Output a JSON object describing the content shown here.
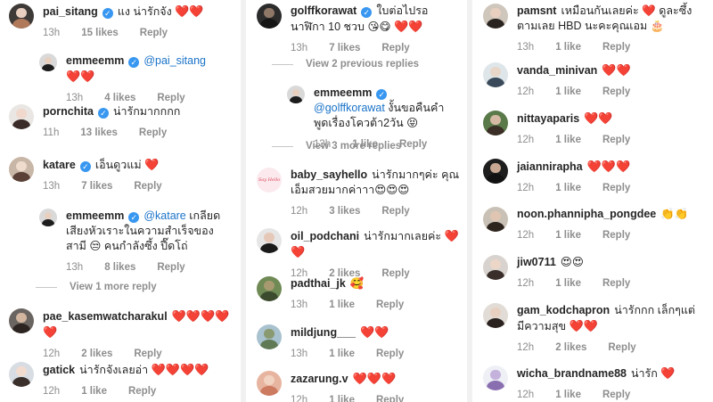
{
  "columns": [
    [
      {
        "user": "pai_sitang",
        "verified": true,
        "text": "แง น่ารักจัง",
        "hearts": "❤️❤️",
        "time": "13h",
        "likes": "15 likes",
        "reply": "Reply",
        "colors": [
          "#3e3a38",
          "#b07a5a",
          "#e8cfc0"
        ]
      },
      {
        "user": "emmeemm",
        "verified": true,
        "mention": "@pai_sitang",
        "text": "",
        "hearts": "❤️❤️",
        "time": "13h",
        "likes": "4 likes",
        "reply": "Reply",
        "colors": [
          "#d9d9d9",
          "#1d1d1d",
          "#e8d0c0"
        ]
      },
      {
        "user": "pornchita",
        "verified": true,
        "text": "น่ารักมากกกก",
        "hearts": "",
        "time": "11h",
        "likes": "13 likes",
        "reply": "Reply",
        "colors": [
          "#e9e6e3",
          "#3a2b28",
          "#f0d8cc"
        ]
      },
      {
        "user": "katare",
        "verified": true,
        "text": "เอ็นดูวแม่",
        "hearts": "❤️",
        "time": "13h",
        "likes": "7 likes",
        "reply": "Reply",
        "colors": [
          "#c8b6a6",
          "#5a4036",
          "#f0dccc"
        ]
      },
      {
        "user": "emmeemm",
        "verified": true,
        "mention": "@katare",
        "text": "เกลียดเสียงหัวเราะในความสำเร็จของสามี 😒 คนกำลังซึ้ง ปี๊ดโถ่",
        "hearts": "",
        "time": "13h",
        "likes": "8 likes",
        "reply": "Reply",
        "colors": [
          "#d9d9d9",
          "#1d1d1d",
          "#e8d0c0"
        ]
      },
      {
        "user": "pae_kasemwatcharakul",
        "verified": false,
        "text": "",
        "hearts": "❤️❤️❤️❤️❤️",
        "time": "12h",
        "likes": "2 likes",
        "reply": "Reply",
        "colors": [
          "#6b6561",
          "#2b2420",
          "#d2b6a0"
        ]
      },
      {
        "user": "gatick",
        "verified": false,
        "text": "น่ารักจังเลยอ่า",
        "hearts": "❤️❤️❤️❤️",
        "time": "12h",
        "likes": "1 like",
        "reply": "Reply",
        "colors": [
          "#d7dde2",
          "#3b2f2b",
          "#f2dcd0"
        ]
      }
    ],
    [
      {
        "user": "golffkorawat",
        "verified": true,
        "text": "ใบต่อไปรอนาฬิกา 10 ชวบ 😘😋",
        "hearts": "❤️❤️",
        "time": "13h",
        "likes": "7 likes",
        "reply": "Reply",
        "colors": [
          "#2c2c2c",
          "#151515",
          "#8f7768"
        ]
      },
      {
        "user": "emmeemm",
        "verified": true,
        "mention": "@golffkorawat",
        "text": "งั้นขอคืนคำพูดเรื่องโควต้า2วัน 😝",
        "hearts": "",
        "time": "13h",
        "likes": "1 like",
        "reply": "Reply",
        "colors": [
          "#d9d9d9",
          "#1d1d1d",
          "#e8d0c0"
        ]
      },
      {
        "user": "baby_sayhello",
        "verified": false,
        "text": "น่ารักมากๆค่ะ คุณเอ็มสวยมากค่าาา😍😍😍",
        "hearts": "",
        "time": "12h",
        "likes": "3 likes",
        "reply": "Reply",
        "colors": [
          "#fbe9ee",
          "#fbe9ee",
          "#fbe9ee"
        ]
      },
      {
        "user": "oil_podchani",
        "verified": false,
        "text": "น่ารักมากเลยค่ะ",
        "hearts": "❤️❤️",
        "time": "12h",
        "likes": "2 likes",
        "reply": "Reply",
        "colors": [
          "#e6e6e6",
          "#1a1a1a",
          "#e6c8b8"
        ]
      },
      {
        "user": "padthai_jk",
        "verified": false,
        "text": "🥰",
        "hearts": "",
        "time": "13h",
        "likes": "1 like",
        "reply": "Reply",
        "colors": [
          "#6f8a55",
          "#3c4a2e",
          "#a89a70"
        ]
      },
      {
        "user": "mildjung___",
        "verified": false,
        "text": "",
        "hearts": "❤️❤️",
        "time": "13h",
        "likes": "1 like",
        "reply": "Reply",
        "colors": [
          "#a9c2cf",
          "#5f7a54",
          "#8a9a70"
        ]
      },
      {
        "user": "zazarung.v",
        "verified": false,
        "text": "",
        "hearts": "❤️❤️❤️",
        "time": "12h",
        "likes": "1 like",
        "reply": "Reply",
        "colors": [
          "#e7b4a0",
          "#cc7a60",
          "#f2d2c0"
        ]
      }
    ],
    [
      {
        "user": "pamsnt",
        "verified": false,
        "text": "เหมือนกันเลยค่ะ ❤️ ดูละซึ้งตามเลย HBD นะคะคุณเอม 🎂",
        "hearts": "",
        "time": "13h",
        "likes": "1 like",
        "reply": "Reply",
        "colors": [
          "#cfc6bc",
          "#2a2420",
          "#e8cfc0"
        ]
      },
      {
        "user": "vanda_minivan",
        "verified": false,
        "text": "",
        "hearts": "❤️❤️",
        "time": "12h",
        "likes": "1 like",
        "reply": "Reply",
        "colors": [
          "#dfe6ea",
          "#3a4a5a",
          "#e8d6c8"
        ]
      },
      {
        "user": "nittayaparis",
        "verified": false,
        "text": "",
        "hearts": "❤️❤️",
        "time": "12h",
        "likes": "1 like",
        "reply": "Reply",
        "colors": [
          "#5a7a4a",
          "#3b2e26",
          "#d6b9a4"
        ]
      },
      {
        "user": "jaiannirapha",
        "verified": false,
        "text": "",
        "hearts": "❤️❤️❤️",
        "time": "12h",
        "likes": "1 like",
        "reply": "Reply",
        "colors": [
          "#1e1e1e",
          "#121212",
          "#c9a893"
        ]
      },
      {
        "user": "noon.phannipha_pongdee",
        "verified": false,
        "text": "👏👏",
        "hearts": "",
        "time": "12h",
        "likes": "1 like",
        "reply": "Reply",
        "colors": [
          "#c9c1b5",
          "#2d241e",
          "#e0c6b2"
        ]
      },
      {
        "user": "jiw0711",
        "verified": false,
        "text": "😍😍",
        "hearts": "",
        "time": "12h",
        "likes": "1 like",
        "reply": "Reply",
        "colors": [
          "#d8d3cf",
          "#3a2e2a",
          "#ecd6c8"
        ]
      },
      {
        "user": "gam_kodchapron",
        "verified": false,
        "text": "น่ารักกก เล็กๆแต่มีความสุข",
        "hearts": "❤️❤️",
        "time": "12h",
        "likes": "2 likes",
        "reply": "Reply",
        "colors": [
          "#e2dcd6",
          "#2a221e",
          "#e8d0c0"
        ]
      },
      {
        "user": "wicha_brandname88",
        "verified": false,
        "text": "น่ารัก",
        "hearts": "❤️",
        "time": "12h",
        "likes": "1 like",
        "reply": "Reply",
        "colors": [
          "#eef0f6",
          "#8a6fb0",
          "#c4b2dc"
        ]
      }
    ]
  ],
  "view_links": [
    {
      "text": "View 1 more reply"
    },
    {
      "text": "View 2 previous replies"
    },
    {
      "text": "View 3 more replies"
    }
  ],
  "avatar_logo_text": "Say Hello"
}
